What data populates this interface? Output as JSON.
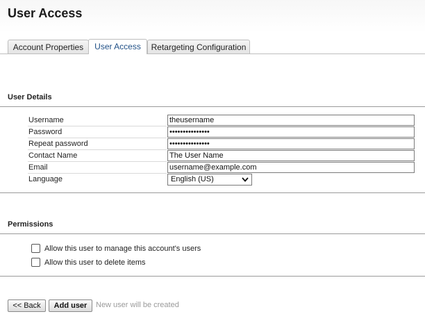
{
  "page": {
    "title": "User Access"
  },
  "tabs": [
    {
      "label": "Account Properties",
      "active": false
    },
    {
      "label": "User Access",
      "active": true
    },
    {
      "label": "Retargeting Configuration",
      "active": false
    }
  ],
  "user_details": {
    "title": "User Details",
    "fields": {
      "username": {
        "label": "Username",
        "value": "theusername"
      },
      "password": {
        "label": "Password",
        "value": "•••••••••••••••"
      },
      "repeat_password": {
        "label": "Repeat password",
        "value": "•••••••••••••••"
      },
      "contact_name": {
        "label": "Contact Name",
        "value": "The User Name"
      },
      "email": {
        "label": "Email",
        "value": "username@example.com"
      },
      "language": {
        "label": "Language",
        "value": "English (US)"
      }
    }
  },
  "permissions": {
    "title": "Permissions",
    "items": [
      {
        "label": "Allow this user to manage this account's users",
        "checked": false
      },
      {
        "label": "Allow this user to delete items",
        "checked": false
      }
    ]
  },
  "actions": {
    "back_label": "<< Back",
    "add_label": "Add user",
    "hint": "New user will be created"
  },
  "icons": {
    "select_chevron": "chevron-down-icon"
  },
  "colors": {
    "active_tab_text": "#1f4f86",
    "hint_text": "#9a9a9a"
  }
}
